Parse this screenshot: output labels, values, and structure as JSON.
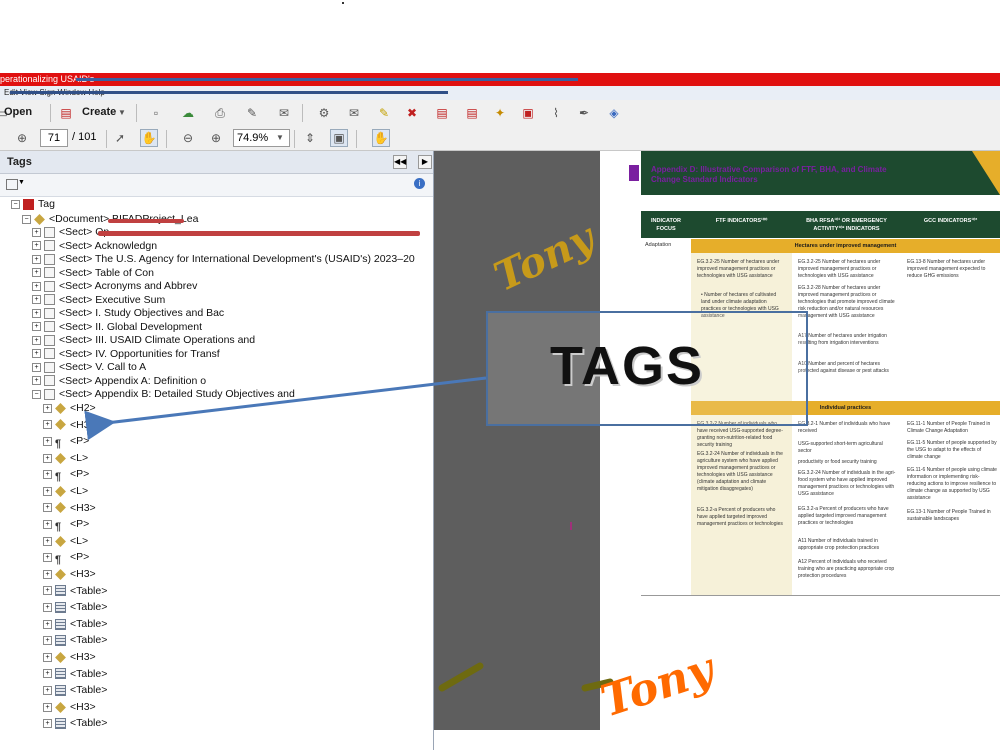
{
  "window": {
    "title_text": "perationalizing USAID's",
    "menu_text": "Edit View Sign Window Help"
  },
  "toolbar": {
    "open_label": "Open",
    "create_label": "Create",
    "page_current": "71",
    "page_total": "/ 101",
    "zoom_value": "74.9%"
  },
  "tags_panel": {
    "title": "Tags",
    "root_label": "Tag",
    "document_label": "<Document> BIFADProject_Lea",
    "sections": [
      {
        "label": "<Sect> Op"
      },
      {
        "label": "<Sect> Acknowledgn"
      },
      {
        "label": "<Sect> The U.S. Agency for International Development's (USAID's) 2023–20"
      },
      {
        "label": "<Sect> Table of Con"
      },
      {
        "label": "<Sect> Acronyms and Abbrev"
      },
      {
        "label": "<Sect> Executive Sum"
      },
      {
        "label": "<Sect> I. Study Objectives and Bac"
      },
      {
        "label": "<Sect> II. Global Development"
      },
      {
        "label": "<Sect> III. USAID Climate Operations and"
      },
      {
        "label": "<Sect> IV. Opportunities for Transf"
      },
      {
        "label": "<Sect> V. Call to A"
      },
      {
        "label": "<Sect> Appendix A: Definition o"
      },
      {
        "label": "<Sect> Appendix B: Detailed Study Objectives and"
      }
    ],
    "children": [
      {
        "label": "<H2>",
        "kind": "tag"
      },
      {
        "label": "<H3>",
        "kind": "tag"
      },
      {
        "label": "<P>",
        "kind": "para"
      },
      {
        "label": "<L>",
        "kind": "tag"
      },
      {
        "label": "<P>",
        "kind": "para"
      },
      {
        "label": "<L>",
        "kind": "tag"
      },
      {
        "label": "<H3>",
        "kind": "tag"
      },
      {
        "label": "<P>",
        "kind": "para"
      },
      {
        "label": "<L>",
        "kind": "tag"
      },
      {
        "label": "<P>",
        "kind": "para"
      },
      {
        "label": "<H3>",
        "kind": "tag"
      },
      {
        "label": "<Table>",
        "kind": "table"
      },
      {
        "label": "<Table>",
        "kind": "table"
      },
      {
        "label": "<Table>",
        "kind": "table"
      },
      {
        "label": "<Table>",
        "kind": "table"
      },
      {
        "label": "<H3>",
        "kind": "tag"
      },
      {
        "label": "<Table>",
        "kind": "table"
      },
      {
        "label": "<Table>",
        "kind": "table"
      },
      {
        "label": "<H3>",
        "kind": "tag"
      },
      {
        "label": "<Table>",
        "kind": "table"
      }
    ]
  },
  "page_content": {
    "appendix_title": "Appendix D: Illustrative Comparison of FTF, BHA, and Climate Change Standard Indicators",
    "columns": [
      "INDICATOR FOCUS",
      "FTF INDICATORS¹⁰⁰",
      "BHA RFSA¹⁰¹ OR EMERGENCY ACTIVITY¹⁰² INDICATORS",
      "GCC INDICATORS¹⁰³"
    ],
    "row_label": "Adaptation",
    "band_1": "Hectares under improved management",
    "band_2": "Individual practices",
    "ftf_1": "EG.3.2-25 Number of hectares under improved management practices or technologies with USG assistance",
    "ftf_1b": "• Number of hectares of cultivated land under climate adaptation practices or technologies with USG assistance",
    "bha_1": "EG.3.2-25 Number of hectares under improved management practices or technologies with USG assistance",
    "bha_1b": "EG.3.2-28 Number of hectares under improved management practices or technologies that promote improved climate risk reduction and/or natural resources management with USG assistance",
    "bha_1c": "A17 Number of hectares under irrigation resulting from irrigation interventions",
    "bha_1d": "A10 Number and percent of hectares protected against disease or pest attacks",
    "gcc_1": "EG.13-8 Number of hectares under improved management expected to reduce GHG emissions",
    "ftf_2": "EG.3.2-2 Number of individuals who have received USG-supported degree-granting non-nutrition-related food security training",
    "ftf_2b": "EG.3.2-24 Number of individuals in the agriculture system who have applied improved management practices or technologies with USG assistance (climate adaptation and climate mitigation disaggregates)",
    "ftf_2c": "EG.3.2-a Percent of producers who have applied targeted improved management practices or technologies",
    "bha_2": "EG.3.2-1 Number of individuals who have received",
    "bha_2b": "USG-supported short-term agricultural sector",
    "bha_2c": "productivity or food security training",
    "bha_2d": "EG.3.2-24 Number of individuals in the agri-food system who have applied improved management practices or technologies with USG assistance",
    "bha_2e": "EG.3.2-a Percent of producers who have applied targeted improved management practices or technologies",
    "bha_2f": "A11 Number of individuals trained in appropriate crop protection practices",
    "bha_2g": "A12 Percent of individuals who received training who are practicing appropriate crop protection procedures",
    "gcc_2": "EG.11-1 Number of People Trained in Climate Change Adaptation",
    "gcc_2b": "EG.11-5 Number of people supported by the USG to adapt to the effects of climate change",
    "gcc_2c": "EG.11-6 Number of people using climate information or implementing risk-reducing actions to improve resilience to climate change as supported by USG assistance",
    "gcc_2d": "EG.13-1 Number of People Trained in sustainable landscapes"
  },
  "annotations": {
    "callout": "TAGS",
    "signature_1": "Tony",
    "signature_2": "Tony",
    "colors": {
      "signature_1": "#c79a1a",
      "signature_2": "#ff6a00",
      "arrow": "#4a78b8"
    }
  }
}
